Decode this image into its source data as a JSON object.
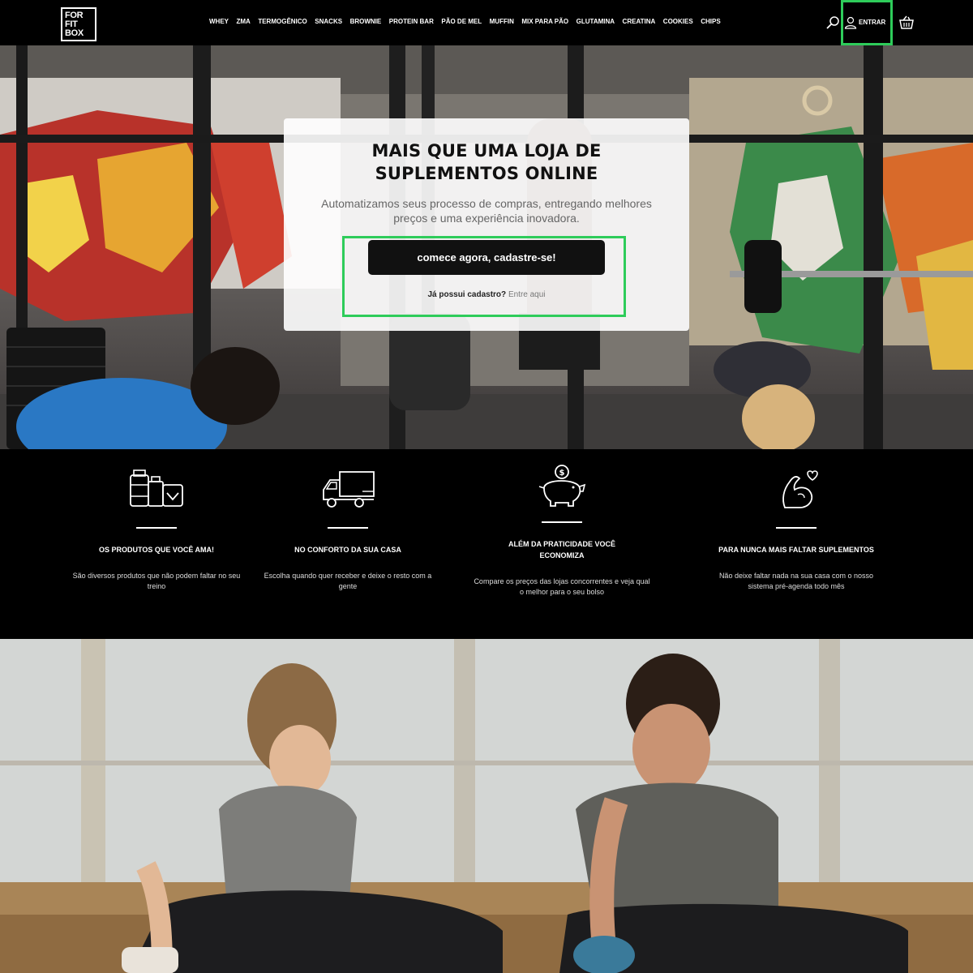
{
  "header": {
    "logo_lines": [
      "FOR",
      "FIT",
      "BOX"
    ],
    "nav": [
      "WHEY",
      "ZMA",
      "TERMOGÊNICO",
      "SNACKS",
      "BROWNIE",
      "PROTEIN BAR",
      "PÃO DE MEL",
      "MUFFIN",
      "MIX PARA PÃO",
      "GLUTAMINA",
      "CREATINA",
      "COOKIES",
      "CHIPS"
    ],
    "login_label": "ENTRAR"
  },
  "hero": {
    "title_line1": "MAIS QUE UMA LOJA DE",
    "title_line2": "SUPLEMENTOS ONLINE",
    "subtitle": "Automatizamos seus processo de compras, entregando melhores preços e uma experiência inovadora.",
    "cta_label": "comece agora, cadastre-se!",
    "already_text": "Já possui cadastro?",
    "enter_link": "Entre aqui"
  },
  "features": [
    {
      "icon": "supplements-icon",
      "title": "OS PRODUTOS QUE VOCÊ AMA!",
      "desc": "São diversos produtos que não podem faltar no seu treino"
    },
    {
      "icon": "truck-icon",
      "title": "NO CONFORTO DA SUA CASA",
      "desc": "Escolha quando quer receber e deixe o resto com a gente"
    },
    {
      "icon": "piggy-bank-icon",
      "title": "ALÉM DA PRATICIDADE VOCÊ ECONOMIZA",
      "desc": "Compare os preços das lojas concorrentes e veja qual o melhor para o seu bolso"
    },
    {
      "icon": "muscle-heart-icon",
      "title": "PARA NUNCA MAIS FALTAR SUPLEMENTOS",
      "desc": "Não deixe faltar nada na sua casa com o nosso sistema pré-agenda todo mês"
    }
  ],
  "colors": {
    "highlight": "#2ecc5a",
    "header_bg": "#000000",
    "button_bg": "#111111"
  }
}
